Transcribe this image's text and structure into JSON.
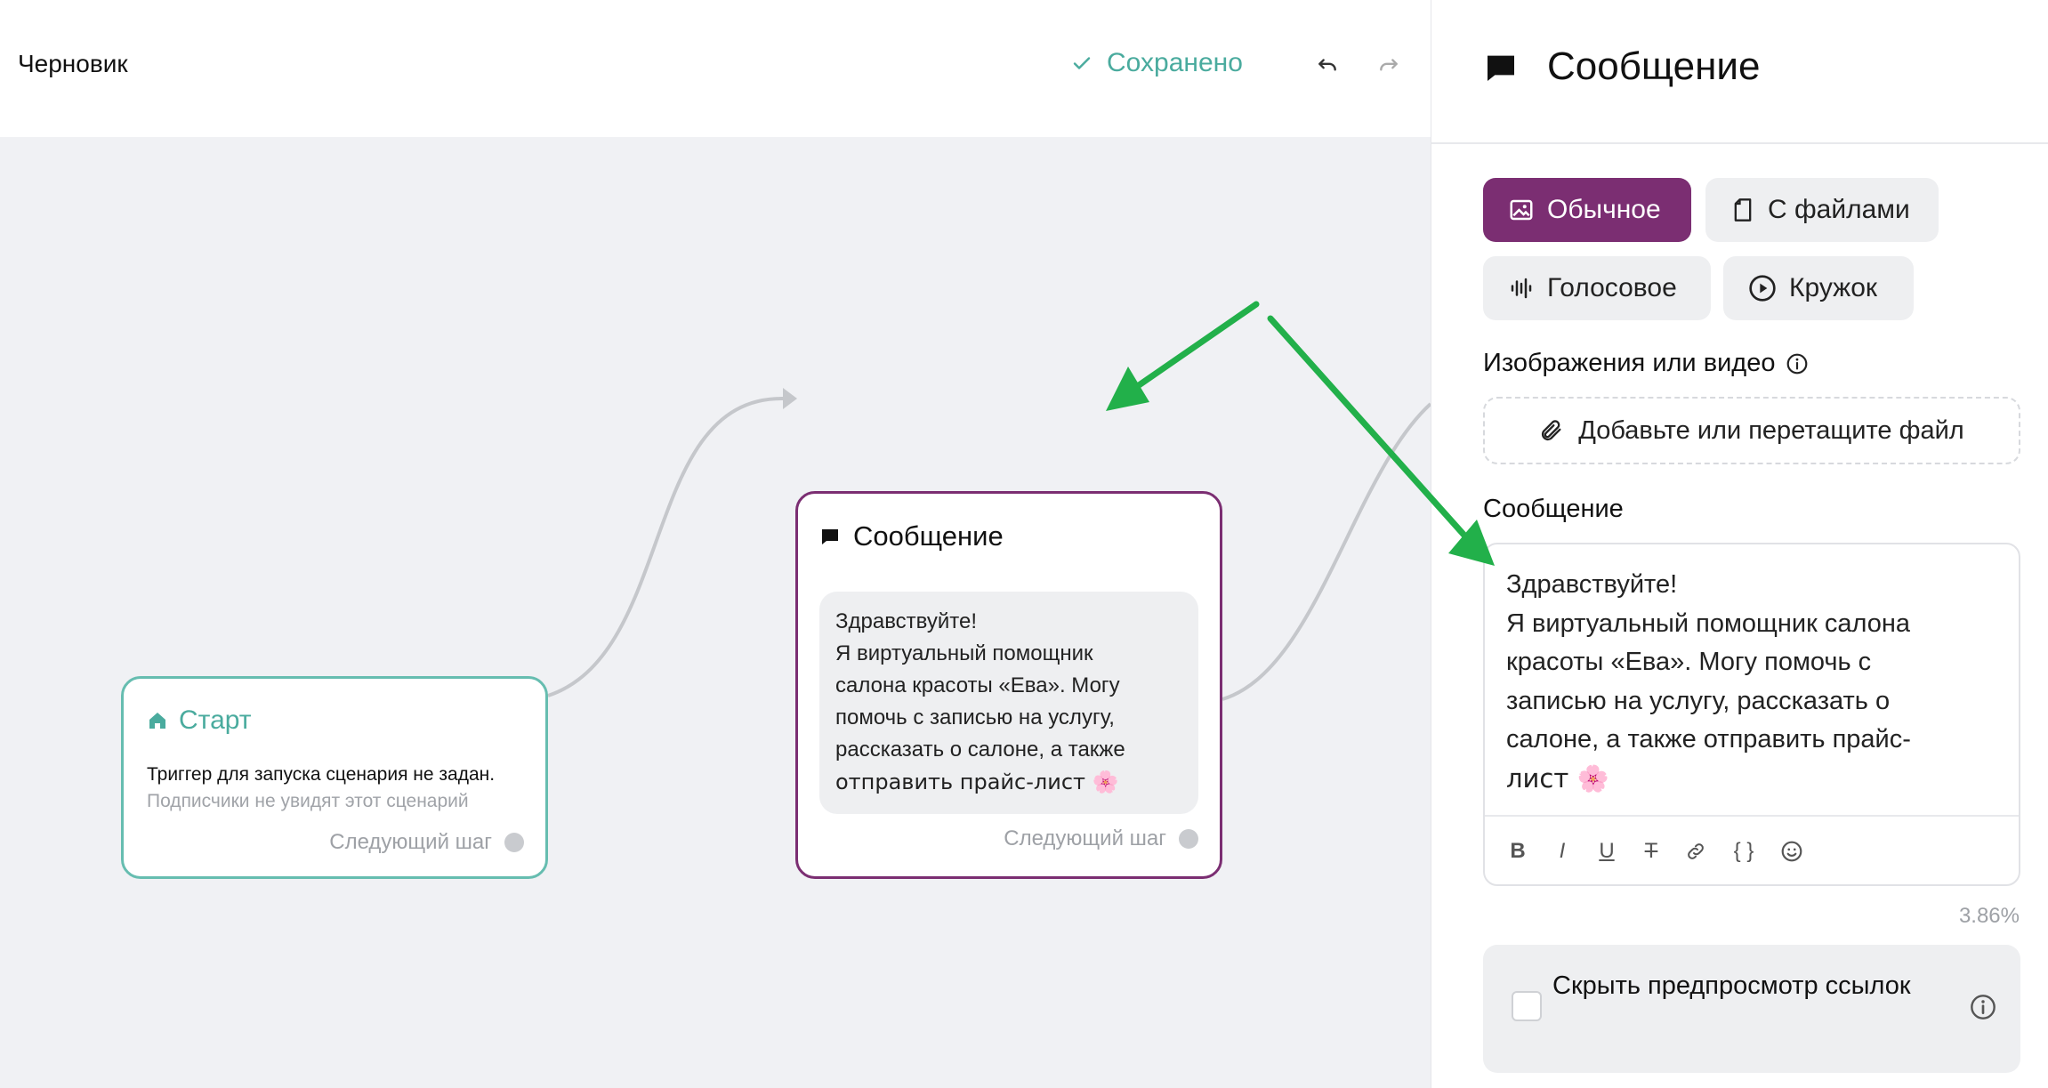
{
  "topbar": {
    "title": "Черновик",
    "saved_label": "Сохранено",
    "colors": {
      "saved": "#4aab9e"
    }
  },
  "canvas": {
    "start_node": {
      "title": "Старт",
      "trigger_text": "Триггер для запуска сценария не задан.",
      "hint_text": "Подписчики не увидят этот сценарий",
      "next_step": "Следующий шаг",
      "accent": "#66bdb0"
    },
    "message_node": {
      "title": "Сообщение",
      "lines": [
        "Здравствуйте!",
        "Я виртуальный помощник",
        "салона красоты «Ева». Могу",
        "помочь с записью на услугу,",
        "рассказать о салоне, а также",
        "отправить прайс-лист 🌸"
      ],
      "next_step": "Следующий шаг",
      "accent": "#7b2e72"
    }
  },
  "panel": {
    "title": "Сообщение",
    "types": {
      "normal": "Обычное",
      "files": "С файлами",
      "voice": "Голосовое",
      "circle": "Кружок"
    },
    "media_label": "Изображения или видео",
    "dropzone_text": "Добавьте или перетащите файл",
    "message_label": "Сообщение",
    "message_lines": [
      "Здравствуйте!",
      "Я виртуальный помощник салона",
      "красоты «Ева». Могу помочь с",
      "записью на услугу, рассказать о",
      "салоне, а также отправить прайс-",
      "лист 🌸"
    ],
    "toolbar": {
      "bold": "B",
      "italic": "I",
      "underline": "U",
      "strike": "T",
      "code": "{ }"
    },
    "counter": "3.86%",
    "hide_preview_label": "Скрыть предпросмотр ссылок",
    "accent": "#7b2e72"
  },
  "annotations": {
    "arrow_color": "#22b04a"
  }
}
